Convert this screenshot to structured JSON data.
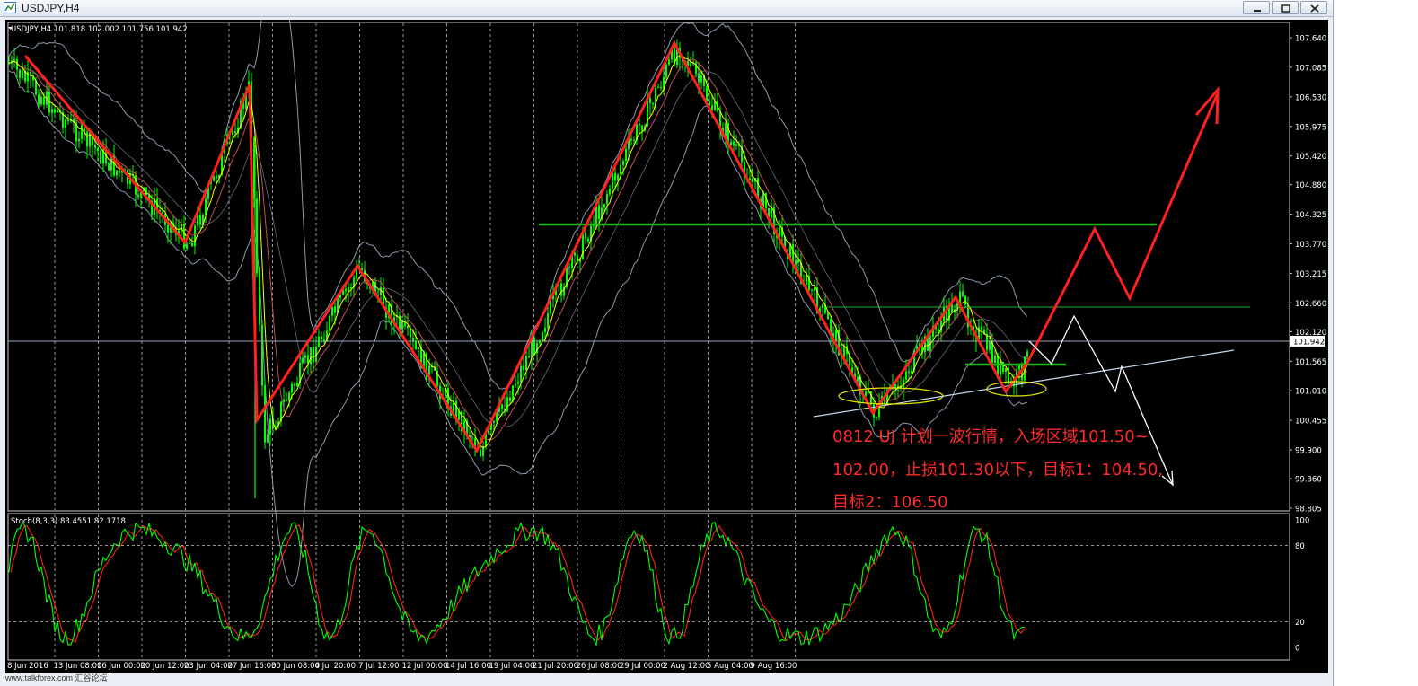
{
  "window": {
    "title": "USDJPY,H4"
  },
  "main_chart": {
    "header": "USDJPY,H4  101.818 102.002 101.756 101.942",
    "current_price": "101.942",
    "price_ticks": [
      "107.640",
      "107.085",
      "106.530",
      "105.975",
      "105.420",
      "104.880",
      "104.325",
      "103.770",
      "103.215",
      "102.660",
      "102.120",
      "101.942",
      "101.565",
      "101.010",
      "100.455",
      "99.900",
      "99.360",
      "98.805"
    ],
    "annotation_lines": [
      "0812 UJ 计划一波行情，入场区域101.50~",
      "102.00，止损101.30以下，目标1：104.50,",
      "目标2：106.50"
    ],
    "colors": {
      "background": "#000000",
      "candle": "#00ff00",
      "zigzag": "#ff2020",
      "projection": "#ffffff",
      "level_line": "#22b522",
      "bollinger": "#8c9ab0",
      "ma_fast": "#ffff00",
      "ma_slow": "#c05050",
      "annotation": "#ff2a2a"
    }
  },
  "stochastic": {
    "header": "Stoch(8,3,3) 83.4551 82.1718",
    "levels": [
      "100",
      "80",
      "20",
      "0"
    ],
    "colors": {
      "main": "#00ff00",
      "signal": "#ff2020"
    }
  },
  "time_axis": {
    "labels": [
      "8 Jun 2016",
      "13 Jun 08:00",
      "16 Jun 00:00",
      "20 Jun 12:00",
      "23 Jun 04:00",
      "27 Jun 16:00",
      "30 Jun 08:00",
      "4 Jul 20:00",
      "7 Jul 12:00",
      "12 Jul 00:00",
      "14 Jul 16:00",
      "19 Jul 04:00",
      "21 Jul 20:00",
      "26 Jul 08:00",
      "29 Jul 00:00",
      "2 Aug 12:00",
      "5 Aug 04:00",
      "9 Aug 16:00"
    ]
  },
  "footer": {
    "watermark": "www.talkforex.com 汇谷论坛"
  }
}
